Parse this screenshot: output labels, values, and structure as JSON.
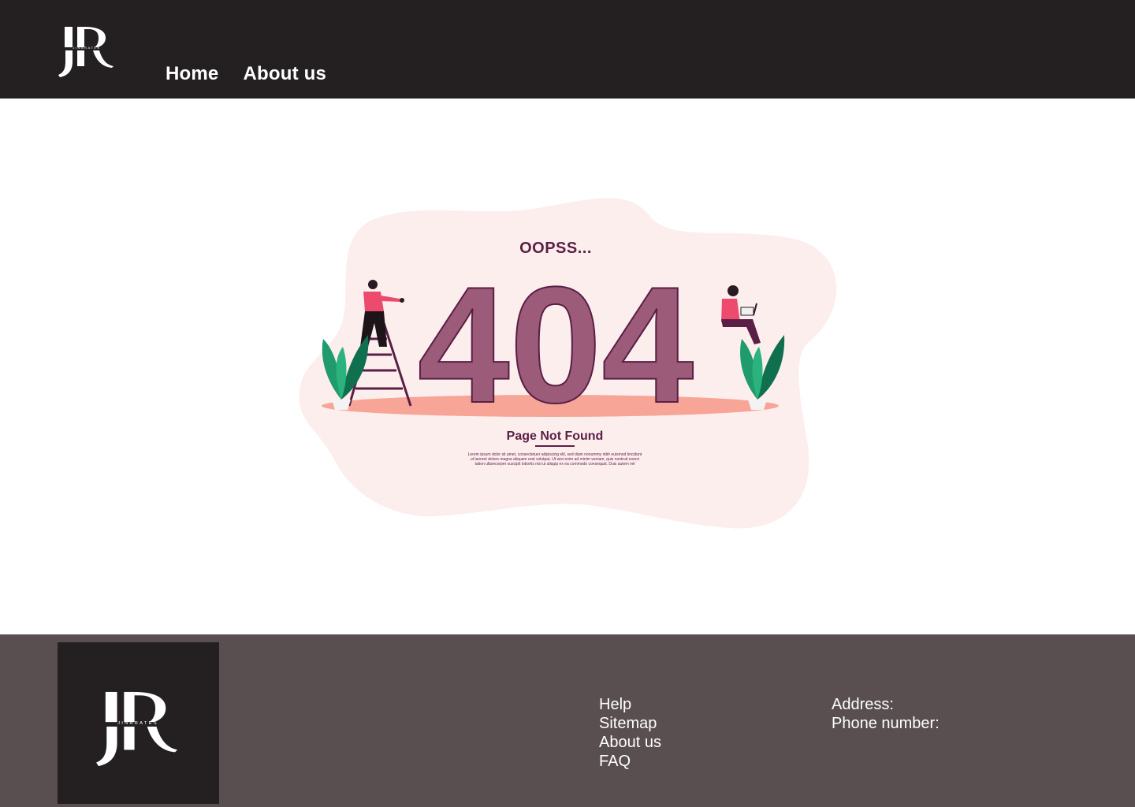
{
  "brand": {
    "logo_letters": "JR",
    "logo_wordmark": "JINARATES"
  },
  "nav": {
    "items": [
      {
        "label": "Home"
      },
      {
        "label": "About us"
      }
    ]
  },
  "error": {
    "exclaim": "OOPSS...",
    "code": "404",
    "title": "Page Not Found",
    "body_lines": [
      "Lorem ipsum dolor sit amet, consectetuer adipiscing elit, sed diam nonummy nibh euismod tincidunt",
      "ut laoreet dolore magna aliquam erat volutpat. Ut wisi enim ad minim veniam, quis nostrud exerci",
      "tation ullamcorper suscipit lobortis nisl ut aliquip ex ea commodo consequat. Duis autem vel"
    ]
  },
  "footer": {
    "links": [
      {
        "label": "Help"
      },
      {
        "label": "Sitemap"
      },
      {
        "label": "About us"
      },
      {
        "label": "FAQ"
      }
    ],
    "contact": {
      "address_label": "Address:",
      "phone_label": "Phone number:"
    }
  },
  "colors": {
    "header_bg": "#242021",
    "footer_bg": "#594f51",
    "accent_plum": "#5a1f45",
    "digit_fill": "#9b5b79",
    "blob_pink": "#fdeeee",
    "floor_salmon": "#f7a597"
  }
}
